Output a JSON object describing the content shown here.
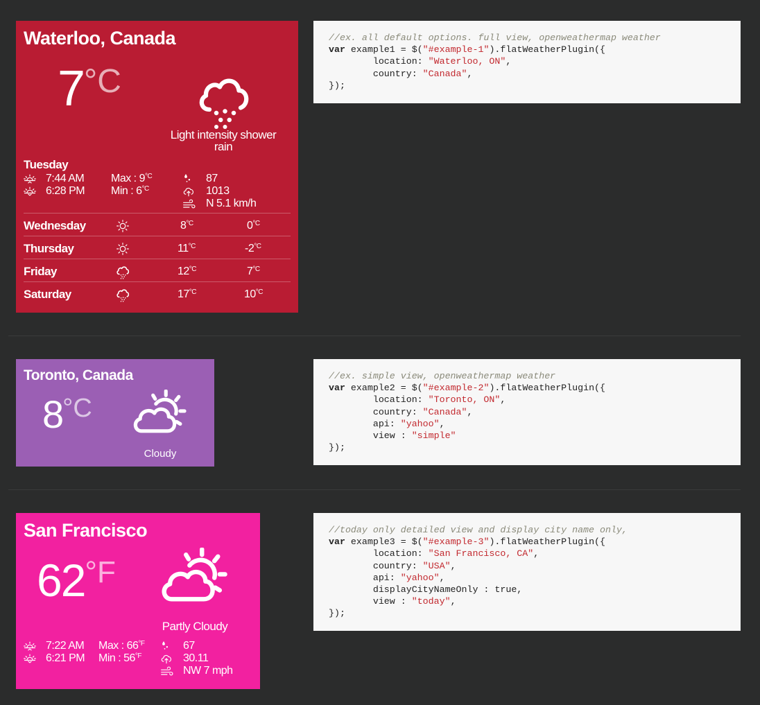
{
  "colors": {
    "example1_bg": "#b91c33",
    "example2_bg": "#9b5fb4",
    "example3_bg": "#f221a0",
    "code_bg": "#f7f7f7",
    "page_bg": "#2b2c2c"
  },
  "example1": {
    "city": "Waterloo, Canada",
    "temp": "7",
    "unit": "°C",
    "icon": "rain-cloud-icon",
    "description": "Light intensity shower rain",
    "today": {
      "day": "Tuesday",
      "sunrise": "7:44 AM",
      "sunset": "6:28 PM",
      "max_label": "Max : 9",
      "min_label": "Min : 6",
      "deg": "°C",
      "humidity": "87",
      "pressure": "1013",
      "wind": "N 5.1 km/h"
    },
    "forecast": [
      {
        "day": "Wednesday",
        "icon": "sun-icon",
        "high": "8",
        "low": "0"
      },
      {
        "day": "Thursday",
        "icon": "sun-icon",
        "high": "11",
        "low": "-2"
      },
      {
        "day": "Friday",
        "icon": "rain-cloud-icon",
        "high": "12",
        "low": "7"
      },
      {
        "day": "Saturday",
        "icon": "rain-cloud-icon",
        "high": "17",
        "low": "10"
      }
    ]
  },
  "example2": {
    "city": "Toronto, Canada",
    "temp": "8",
    "unit": "°C",
    "icon": "cloud-sun-icon",
    "description": "Cloudy"
  },
  "example3": {
    "city": "San Francisco",
    "temp": "62",
    "unit": "°F",
    "icon": "cloud-sun-icon",
    "description": "Partly Cloudy",
    "today": {
      "sunrise": "7:22 AM",
      "sunset": "6:21 PM",
      "max_label": "Max : 66",
      "min_label": "Min : 56",
      "deg": "°F",
      "humidity": "67",
      "pressure": "30.11",
      "wind": "NW 7 mph"
    }
  },
  "code1": {
    "comment": "//ex. all default options. full view, openweathermap weather",
    "l1_kw": "var",
    "l1_rest": " example1 = $(",
    "l1_str": "\"#example-1\"",
    "l1_end": ").flatWeatherPlugin({",
    "l2_key": "        location: ",
    "l2_str": "\"Waterloo, ON\"",
    "l2_end": ",",
    "l3_key": "        country: ",
    "l3_str": "\"Canada\"",
    "l3_end": ",",
    "l4": "});"
  },
  "code2": {
    "comment": "//ex. simple view, openweathermap weather",
    "l1_kw": "var",
    "l1_rest": " example2 = $(",
    "l1_str": "\"#example-2\"",
    "l1_end": ").flatWeatherPlugin({",
    "l2_key": "        location: ",
    "l2_str": "\"Toronto, ON\"",
    "l2_end": ",",
    "l3_key": "        country: ",
    "l3_str": "\"Canada\"",
    "l3_end": ",",
    "l4_key": "        api: ",
    "l4_str": "\"yahoo\"",
    "l4_end": ",",
    "l5_key": "        view : ",
    "l5_str": "\"simple\"",
    "l6": "});"
  },
  "code3": {
    "comment": "//today only detailed view and display city name only,",
    "l1_kw": "var",
    "l1_rest": " example3 = $(",
    "l1_str": "\"#example-3\"",
    "l1_end": ").flatWeatherPlugin({",
    "l2_key": "        location: ",
    "l2_str": "\"San Francisco, CA\"",
    "l2_end": ",",
    "l3_key": "        country: ",
    "l3_str": "\"USA\"",
    "l3_end": ",",
    "l4_key": "        api: ",
    "l4_str": "\"yahoo\"",
    "l4_end": ",",
    "l5": "        displayCityNameOnly : true,",
    "l6_key": "        view : ",
    "l6_str": "\"today\"",
    "l6_end": ",",
    "l7": "});"
  }
}
